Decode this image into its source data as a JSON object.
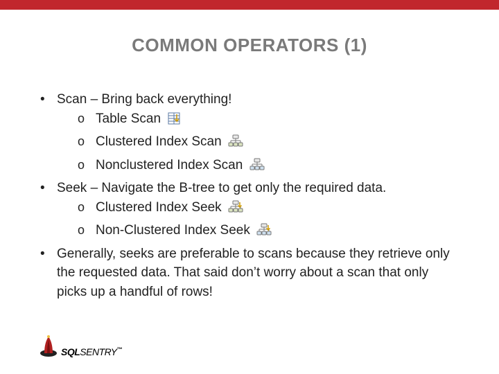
{
  "title": "COMMON OPERATORS (1)",
  "bullets": {
    "b0": "Scan – Bring back everything!",
    "b0s0": "Table Scan",
    "b0s1": "Clustered Index Scan",
    "b0s2": "Nonclustered Index Scan",
    "b1": "Seek – Navigate the B-tree to get only the required data.",
    "b1s0": "Clustered Index Seek",
    "b1s1": "Non-Clustered Index Seek",
    "b2": "Generally, seeks are preferable to scans because they retrieve only the requested data.  That said don’t worry about a scan that only picks up a handful of rows!"
  },
  "sub_marker": "o",
  "icons": {
    "table_scan": "table-scan-icon",
    "clustered_scan": "clustered-index-scan-icon",
    "nonclustered_scan": "nonclustered-index-scan-icon",
    "clustered_seek": "clustered-index-seek-icon",
    "nonclustered_seek": "nonclustered-index-seek-icon"
  },
  "logo": {
    "brand_p1": "SQL",
    "brand_p2": "SENTRY",
    "tm": "™"
  }
}
